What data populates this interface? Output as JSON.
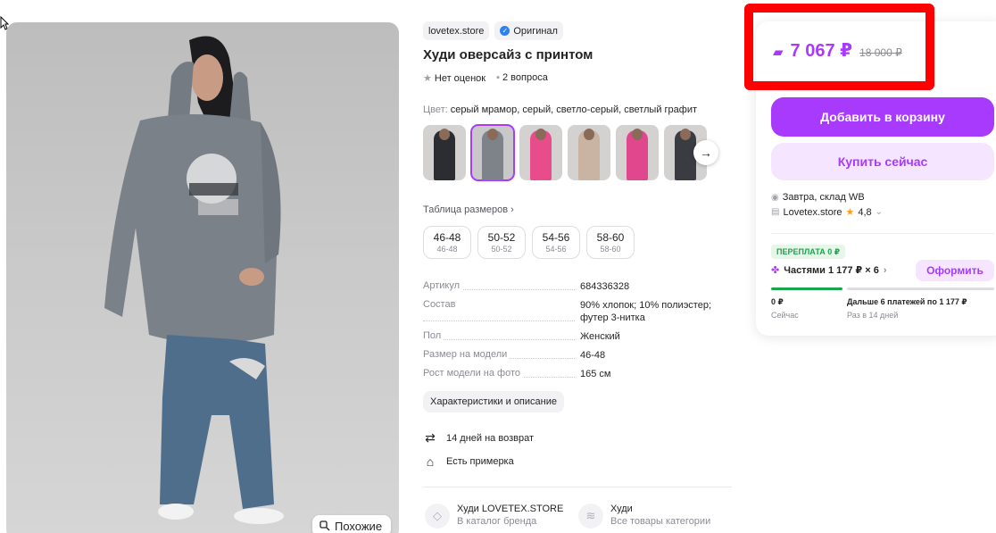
{
  "gallery": {
    "similar_label": "Похожие"
  },
  "product": {
    "brand": "lovetex.store",
    "original_label": "Оригинал",
    "title": "Худи оверсайз с принтом",
    "rating_text": "Нет оценок",
    "questions_text": "2 вопроса",
    "color_label": "Цвет:",
    "color_value": "серый мрамор, серый, светло-серый, светлый графит",
    "thumbnails": [
      {
        "color": "#2b2d33"
      },
      {
        "color": "#7d8389"
      },
      {
        "color": "#e94c8a"
      },
      {
        "color": "#c9b3a3"
      },
      {
        "color": "#e0478c"
      },
      {
        "color": "#3a3c42"
      }
    ],
    "size_table_link": "Таблица размеров",
    "sizes": [
      {
        "label": "46-48",
        "ru": "46-48"
      },
      {
        "label": "50-52",
        "ru": "50-52"
      },
      {
        "label": "54-56",
        "ru": "54-56"
      },
      {
        "label": "58-60",
        "ru": "58-60"
      }
    ],
    "specs": [
      {
        "key": "Артикул",
        "value": "684336328"
      },
      {
        "key": "Состав",
        "value": "90% хлопок; 10% полиэстер; футер 3-нитка"
      },
      {
        "key": "Пол",
        "value": "Женский"
      },
      {
        "key": "Размер на модели",
        "value": "46-48"
      },
      {
        "key": "Рост модели на фото",
        "value": "165 см"
      }
    ],
    "characteristics_button": "Характеристики и описание",
    "features": [
      {
        "icon": "return-icon",
        "text": "14 дней на возврат"
      },
      {
        "icon": "hanger-icon",
        "text": "Есть примерка"
      }
    ],
    "categories": [
      {
        "title": "Худи LOVETEX.STORE",
        "subtitle": "В каталог бренда"
      },
      {
        "title": "Худи",
        "subtitle": "Все товары категории"
      }
    ]
  },
  "buy_card": {
    "price": "7 067 ₽",
    "old_price": "18 000 ₽",
    "add_to_cart": "Добавить в корзину",
    "buy_now": "Купить сейчас",
    "delivery": "Завтра, склад WB",
    "seller": "Lovetex.store",
    "seller_rating": "4,8",
    "overpay_badge": "ПЕРЕПЛАТА 0 ₽",
    "installments": "Частями 1 177 ₽ × 6",
    "apply_button": "Оформить",
    "plan_now_amount": "0 ₽",
    "plan_now_label": "Сейчас",
    "plan_later_amount": "Дальше 6 платежей по 1 177 ₽",
    "plan_later_label": "Раз в 14 дней",
    "accent_color": "#a73afd",
    "highlight_color": "#ff0000"
  }
}
